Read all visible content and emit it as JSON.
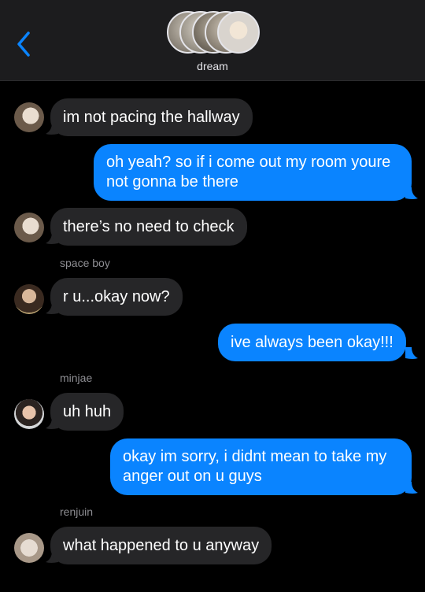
{
  "header": {
    "title": "dream",
    "back_icon": "chevron-left-icon"
  },
  "colors": {
    "incoming_bubble": "#262628",
    "outgoing_bubble": "#0a84ff",
    "background": "#000000",
    "header": "#1c1c1e"
  },
  "messages": [
    {
      "direction": "in",
      "text": "im not pacing the hallway"
    },
    {
      "direction": "out",
      "text_line1": "oh yeah? so if i come out my room youre",
      "text_line2": "not gonna be there"
    },
    {
      "direction": "in",
      "text": "there’s no need to check"
    },
    {
      "sender": "space boy",
      "direction": "in",
      "text": "r u...okay now?"
    },
    {
      "direction": "out",
      "text": "ive always been okay!!!"
    },
    {
      "sender": "minjae",
      "direction": "in",
      "text": "uh huh"
    },
    {
      "direction": "out",
      "text_line1": "okay im sorry, i didnt mean to take my",
      "text_line2": "anger out on u guys"
    },
    {
      "sender": "renjuin",
      "direction": "in",
      "text": "what happened to u anyway"
    }
  ]
}
